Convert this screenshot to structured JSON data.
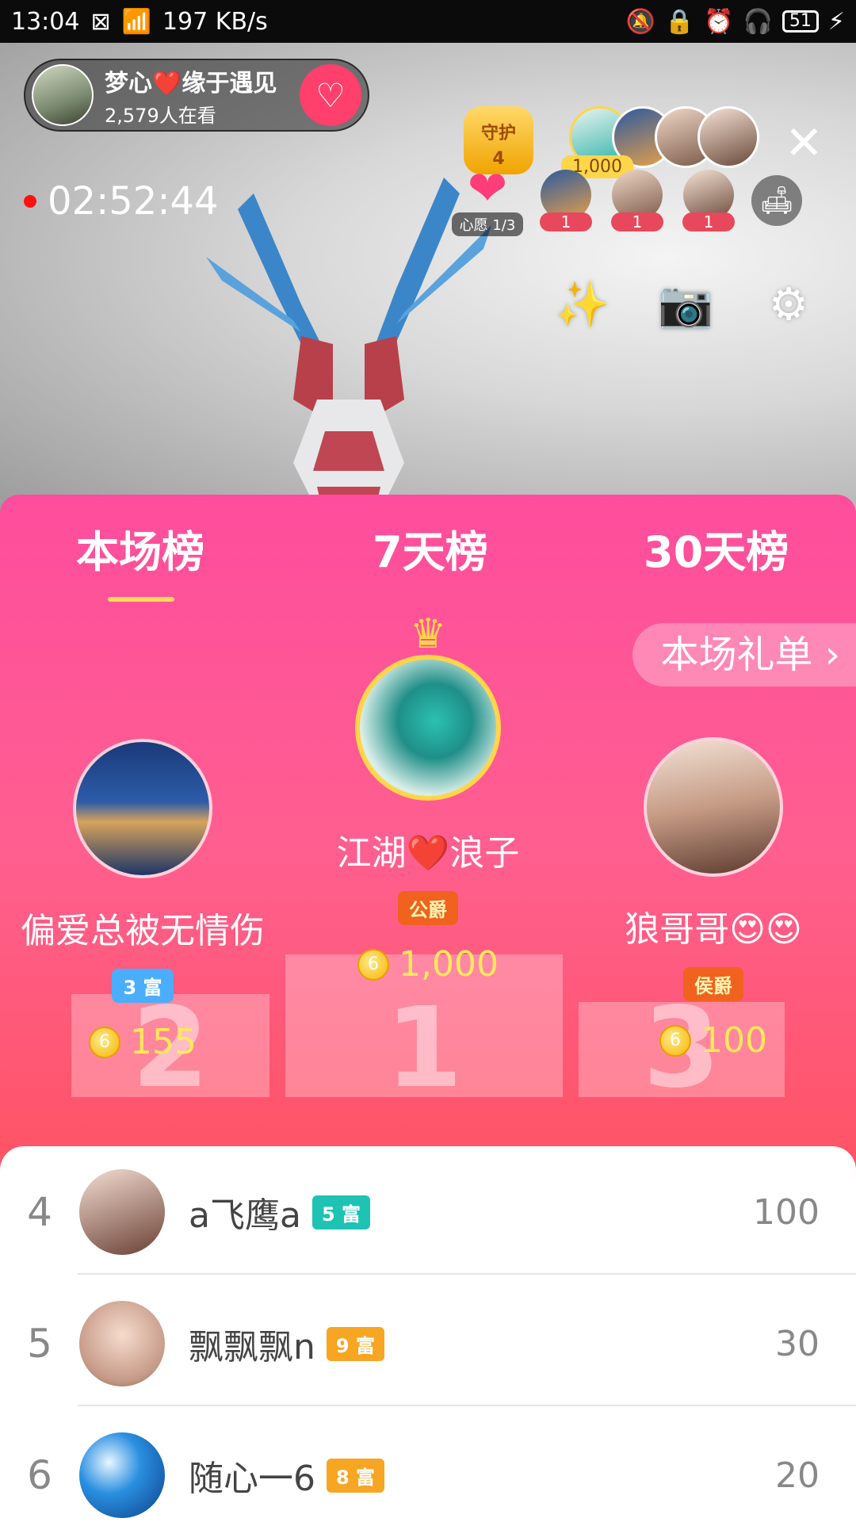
{
  "status_bar": {
    "time": "13:04",
    "speed": "197 KB/s",
    "battery": "51"
  },
  "live": {
    "host_name": "梦心❤️缘于遇见",
    "viewers": "2,579人在看",
    "guard_label": "守护",
    "guard_count": "4",
    "top_score": "1,000",
    "timer": "02:52:44",
    "wish_label": "心愿 1/3",
    "seats": [
      "1",
      "1",
      "1"
    ]
  },
  "tabs": [
    "本场榜",
    "7天榜",
    "30天榜"
  ],
  "gift_list_label": "本场礼单 ›",
  "podium": {
    "first": {
      "name": "江湖❤️浪子",
      "badge": "公爵",
      "score": "1,000"
    },
    "second": {
      "name": "偏爱总被无情伤",
      "badge": "3 富",
      "score": "155"
    },
    "third": {
      "name": "狼哥哥😍😍",
      "badge": "侯爵",
      "score": "100"
    },
    "numbers": [
      "1",
      "2",
      "3"
    ]
  },
  "list": [
    {
      "rank": "4",
      "name": "a飞鹰a",
      "level": "5 富",
      "value": "100"
    },
    {
      "rank": "5",
      "name": "飘飘飘n",
      "level": "9 富",
      "value": "30"
    },
    {
      "rank": "6",
      "name": "随心一6",
      "level": "8 富",
      "value": "20"
    }
  ],
  "colors": {
    "panel_pink": "#fe4d9d",
    "panel_red": "#ff5466",
    "score_yellow": "#ffe95a",
    "level_teal": "#1ec3b3",
    "level_orange": "#f6a623",
    "level_blue": "#4aaefc"
  }
}
